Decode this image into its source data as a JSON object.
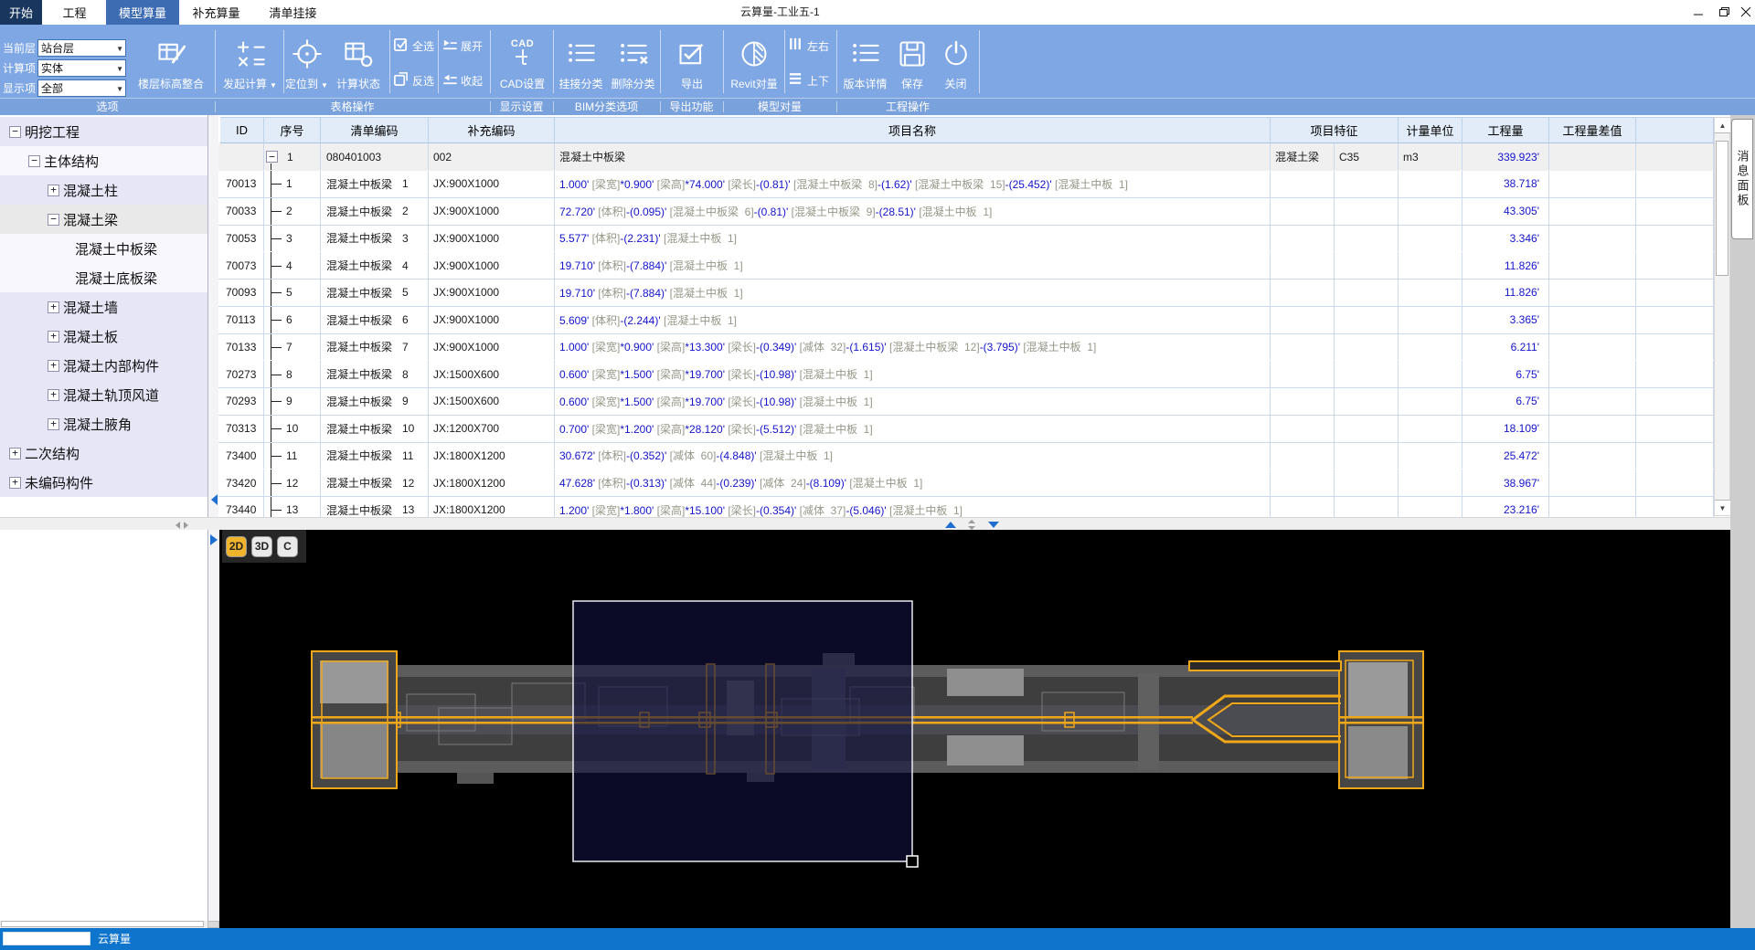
{
  "window": {
    "title": "云算量-工业五-1"
  },
  "tabs": {
    "items": [
      "开始",
      "工程",
      "模型算量",
      "补充算量",
      "清单挂接"
    ],
    "active": "模型算量"
  },
  "ribbon": {
    "fields": [
      {
        "label": "当前层",
        "value": "站台层"
      },
      {
        "label": "计算项",
        "value": "实体"
      },
      {
        "label": "显示项",
        "value": "全部"
      }
    ],
    "buttons": {
      "floor_merge": "楼层标高整合",
      "start_calc": "发起计算",
      "locate": "定位到",
      "calc_status": "计算状态",
      "select_all": "全选",
      "invert_select": "反选",
      "expand": "展开",
      "collapse": "收起",
      "cad_settings": "CAD设置",
      "link_category": "挂接分类",
      "delete_category": "删除分类",
      "export": "导出",
      "revit_compare": "Revit对量",
      "left_right": "左右",
      "up_down": "上下",
      "version_details": "版本详情",
      "save": "保存",
      "close": "关闭"
    },
    "group_labels": [
      "选项",
      "表格操作",
      "显示设置",
      "BIM分类选项",
      "导出功能",
      "模型对量",
      "工程操作"
    ]
  },
  "sidebar": {
    "items": [
      {
        "label": "明挖工程",
        "level": 0,
        "expander": "minus",
        "tone": "lav"
      },
      {
        "label": "主体结构",
        "level": 1,
        "expander": "minus",
        "tone": "light"
      },
      {
        "label": "混凝土柱",
        "level": 2,
        "expander": "plus",
        "tone": "lav"
      },
      {
        "label": "混凝土梁",
        "level": 2,
        "expander": "minus",
        "tone": "sel"
      },
      {
        "label": "混凝土中板梁",
        "level": 3,
        "expander": "none",
        "tone": "light"
      },
      {
        "label": "混凝土底板梁",
        "level": 3,
        "expander": "none",
        "tone": "light"
      },
      {
        "label": "混凝土墙",
        "level": 2,
        "expander": "plus",
        "tone": "lav"
      },
      {
        "label": "混凝土板",
        "level": 2,
        "expander": "plus",
        "tone": "lav"
      },
      {
        "label": "混凝土内部构件",
        "level": 2,
        "expander": "plus",
        "tone": "lav"
      },
      {
        "label": "混凝土轨顶风道",
        "level": 2,
        "expander": "plus",
        "tone": "lav"
      },
      {
        "label": "混凝土腋角",
        "level": 2,
        "expander": "plus",
        "tone": "lav"
      },
      {
        "label": "二次结构",
        "level": 0,
        "expander": "plus",
        "tone": "lav"
      },
      {
        "label": "未编码构件",
        "level": 0,
        "expander": "plus",
        "tone": "lav"
      }
    ]
  },
  "table": {
    "headers": [
      "ID",
      "序号",
      "清单编码",
      "补充编码",
      "项目名称",
      "项目特征",
      "计量单位",
      "工程量",
      "工程量差值"
    ],
    "group_row": {
      "seq": "1",
      "list_code": "080401003",
      "supp_code": "002",
      "name": "混凝土中板梁",
      "feature": "混凝土梁",
      "grade": "C35",
      "unit": "m3",
      "quantity": "339.923'"
    },
    "rows": [
      {
        "id": "70013",
        "seq": "1",
        "list_code": "混凝土中板梁",
        "list_index": "1",
        "supp_code": "JX:900X1000",
        "name": "1.000' [梁宽]*0.900' [梁高]*74.000' [梁长]-(0.81)' [混凝土中板梁  8]-(1.62)' [混凝土中板梁  15]-(25.452)' [混凝土中板  1]",
        "quantity": "38.718'"
      },
      {
        "id": "70033",
        "seq": "2",
        "list_code": "混凝土中板梁",
        "list_index": "2",
        "supp_code": "JX:900X1000",
        "name": "72.720' [体积]-(0.095)' [混凝土中板梁  6]-(0.81)' [混凝土中板梁  9]-(28.51)' [混凝土中板  1]",
        "quantity": "43.305'"
      },
      {
        "id": "70053",
        "seq": "3",
        "list_code": "混凝土中板梁",
        "list_index": "3",
        "supp_code": "JX:900X1000",
        "name": "5.577' [体积]-(2.231)' [混凝土中板  1]",
        "quantity": "3.346'"
      },
      {
        "id": "70073",
        "seq": "4",
        "list_code": "混凝土中板梁",
        "list_index": "4",
        "supp_code": "JX:900X1000",
        "name": "19.710' [体积]-(7.884)' [混凝土中板  1]",
        "quantity": "11.826'"
      },
      {
        "id": "70093",
        "seq": "5",
        "list_code": "混凝土中板梁",
        "list_index": "5",
        "supp_code": "JX:900X1000",
        "name": "19.710' [体积]-(7.884)' [混凝土中板  1]",
        "quantity": "11.826'"
      },
      {
        "id": "70113",
        "seq": "6",
        "list_code": "混凝土中板梁",
        "list_index": "6",
        "supp_code": "JX:900X1000",
        "name": "5.609' [体积]-(2.244)' [混凝土中板  1]",
        "quantity": "3.365'"
      },
      {
        "id": "70133",
        "seq": "7",
        "list_code": "混凝土中板梁",
        "list_index": "7",
        "supp_code": "JX:900X1000",
        "name": "1.000' [梁宽]*0.900' [梁高]*13.300' [梁长]-(0.349)' [减体  32]-(1.615)' [混凝土中板梁  12]-(3.795)' [混凝土中板  1]",
        "quantity": "6.211'"
      },
      {
        "id": "70273",
        "seq": "8",
        "list_code": "混凝土中板梁",
        "list_index": "8",
        "supp_code": "JX:1500X600",
        "name": "0.600' [梁宽]*1.500' [梁高]*19.700' [梁长]-(10.98)' [混凝土中板  1]",
        "quantity": "6.75'"
      },
      {
        "id": "70293",
        "seq": "9",
        "list_code": "混凝土中板梁",
        "list_index": "9",
        "supp_code": "JX:1500X600",
        "name": "0.600' [梁宽]*1.500' [梁高]*19.700' [梁长]-(10.98)' [混凝土中板  1]",
        "quantity": "6.75'"
      },
      {
        "id": "70313",
        "seq": "10",
        "list_code": "混凝土中板梁",
        "list_index": "10",
        "supp_code": "JX:1200X700",
        "name": "0.700' [梁宽]*1.200' [梁高]*28.120' [梁长]-(5.512)' [混凝土中板  1]",
        "quantity": "18.109'"
      },
      {
        "id": "73400",
        "seq": "11",
        "list_code": "混凝土中板梁",
        "list_index": "11",
        "supp_code": "JX:1800X1200",
        "name": "30.672' [体积]-(0.352)' [减体  60]-(4.848)' [混凝土中板  1]",
        "quantity": "25.472'"
      },
      {
        "id": "73420",
        "seq": "12",
        "list_code": "混凝土中板梁",
        "list_index": "12",
        "supp_code": "JX:1800X1200",
        "name": "47.628' [体积]-(0.313)' [减体  44]-(0.239)' [减体  24]-(8.109)' [混凝土中板  1]",
        "quantity": "38.967'"
      },
      {
        "id": "73440",
        "seq": "13",
        "list_code": "混凝土中板梁",
        "list_index": "13",
        "supp_code": "JX:1800X1200",
        "name": "1.200' [梁宽]*1.800' [梁高]*15.100' [梁长]-(0.354)' [减体  37]-(5.046)' [混凝土中板  1]",
        "quantity": "23.216'"
      }
    ]
  },
  "viewport": {
    "modes": [
      "2D",
      "3D",
      "C"
    ],
    "active": "2D"
  },
  "message_panel": {
    "label": "消息面板"
  },
  "statusbar": {
    "app_name": "云算量"
  },
  "colors": {
    "ribbon": "#7ea7e4",
    "formula_blue": "#1414cc",
    "cad_yellow": "#f0a818",
    "statusbar_blue": "#0e74cc",
    "selection_fill": "#111140"
  }
}
